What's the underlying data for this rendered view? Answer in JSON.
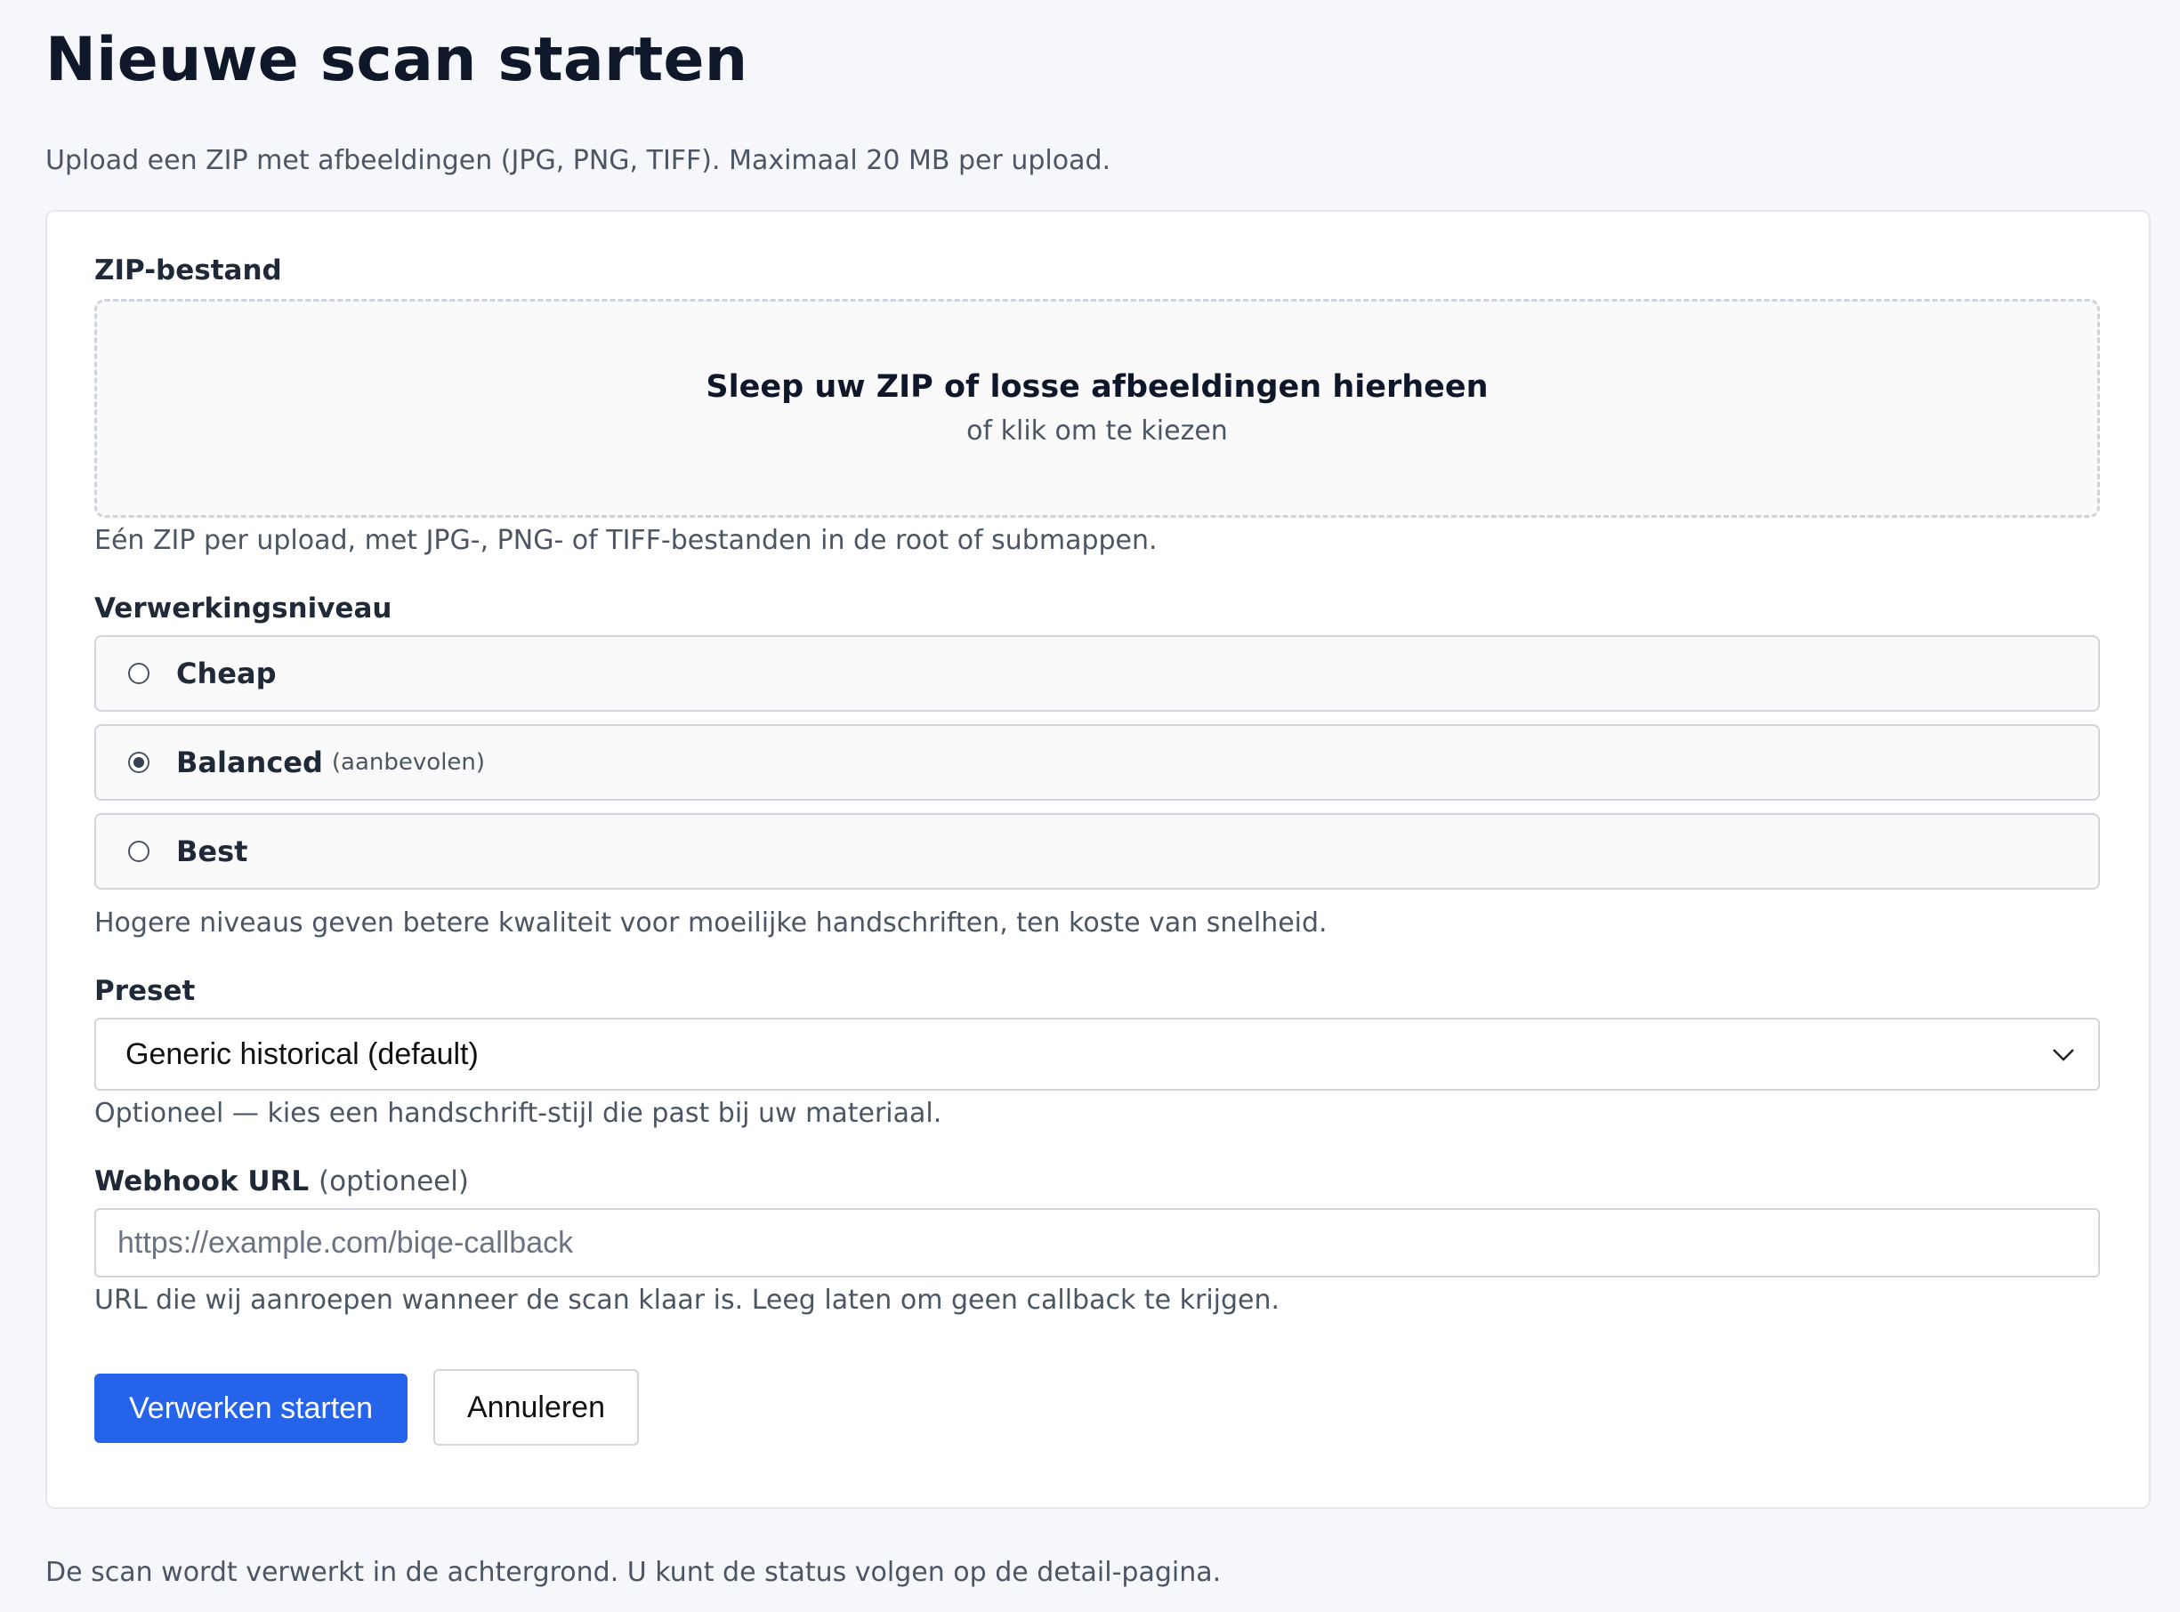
{
  "page": {
    "title": "Nieuwe scan starten",
    "intro": "Upload een ZIP met afbeeldingen (JPG, PNG, TIFF). Maximaal 20 MB per upload.",
    "footer_note": "De scan wordt verwerkt in de achtergrond. U kunt de status volgen op de detail-pagina."
  },
  "form": {
    "zip": {
      "label": "ZIP-bestand",
      "dropzone_title": "Sleep uw ZIP of losse afbeeldingen hierheen",
      "dropzone_subtitle": "of klik om te kiezen",
      "help": "Eén ZIP per upload, met JPG-, PNG- of TIFF-bestanden in de root of submappen."
    },
    "level": {
      "label": "Verwerkingsniveau",
      "options": [
        {
          "label": "Cheap",
          "hint": "",
          "checked": false
        },
        {
          "label": "Balanced",
          "hint": "(aanbevolen)",
          "checked": true
        },
        {
          "label": "Best",
          "hint": "",
          "checked": false
        }
      ],
      "help": "Hogere niveaus geven betere kwaliteit voor moeilijke handschriften, ten koste van snelheid."
    },
    "preset": {
      "label": "Preset",
      "selected": "Generic historical (default)",
      "help": "Optioneel — kies een handschrift-stijl die past bij uw materiaal."
    },
    "webhook": {
      "label": "Webhook URL",
      "label_suffix": "(optioneel)",
      "placeholder": "https://example.com/biqe-callback",
      "help": "URL die wij aanroepen wanneer de scan klaar is. Leeg laten om geen callback te krijgen."
    },
    "actions": {
      "submit": "Verwerken starten",
      "cancel": "Annuleren"
    }
  },
  "colors": {
    "primary": "#2563eb",
    "background": "#f6f7fa"
  }
}
